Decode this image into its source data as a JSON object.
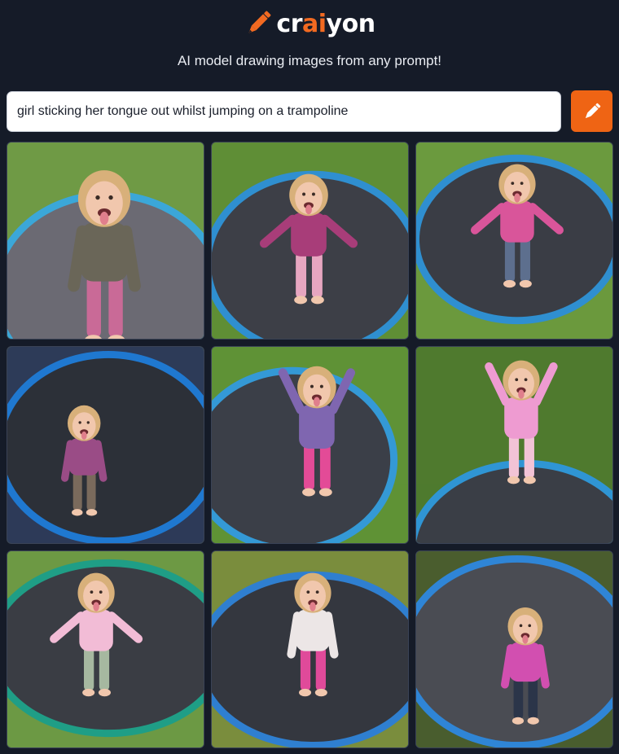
{
  "app": {
    "logo_prefix": "cr",
    "logo_accent": "ai",
    "logo_suffix": "yon",
    "tagline": "AI model drawing images from any prompt!"
  },
  "search": {
    "value": "girl sticking her tongue out whilst jumping on a trampoline",
    "button_icon": "pencil-icon"
  },
  "colors": {
    "background": "#151b28",
    "accent": "#f26a21",
    "button": "#ef6414"
  },
  "results": [
    {
      "id": 1,
      "shirt": "#6a6658",
      "pants": "#c96a97",
      "bg": "#6f9a45",
      "mat": "#6b6a73",
      "rim": "#3ba7d8"
    },
    {
      "id": 2,
      "shirt": "#a83d79",
      "pants": "#e7a6c0",
      "bg": "#5f8e36",
      "mat": "#3d3f47",
      "rim": "#2f8fd0"
    },
    {
      "id": 3,
      "shirt": "#d9559a",
      "pants": "#5d6f8e",
      "bg": "#6b9a3e",
      "mat": "#3a3d45",
      "rim": "#2f8fd0"
    },
    {
      "id": 4,
      "shirt": "#9a4c86",
      "pants": "#7a6a5c",
      "bg": "#2d3b58",
      "mat": "#2c3038",
      "rim": "#1f78d0"
    },
    {
      "id": 5,
      "shirt": "#7f66b0",
      "pants": "#e34b97",
      "bg": "#5f9236",
      "mat": "#3b3f48",
      "rim": "#3499d6"
    },
    {
      "id": 6,
      "shirt": "#ee9bd1",
      "pants": "#f2c3d6",
      "bg": "#4f7a2e",
      "mat": "#3a3e46",
      "rim": "#2f95d4"
    },
    {
      "id": 7,
      "shirt": "#f2bcd6",
      "pants": "#a6b8a0",
      "bg": "#6d9944",
      "mat": "#3a3d44",
      "rim": "#1f9e86"
    },
    {
      "id": 8,
      "shirt": "#ece6e6",
      "pants": "#e04a9a",
      "bg": "#7a8d3d",
      "mat": "#34373f",
      "rim": "#2f7fd0"
    },
    {
      "id": 9,
      "shirt": "#d24fb0",
      "pants": "#2b3549",
      "bg": "#4a5d2e",
      "mat": "#4a4c53",
      "rim": "#2f85d6"
    }
  ]
}
